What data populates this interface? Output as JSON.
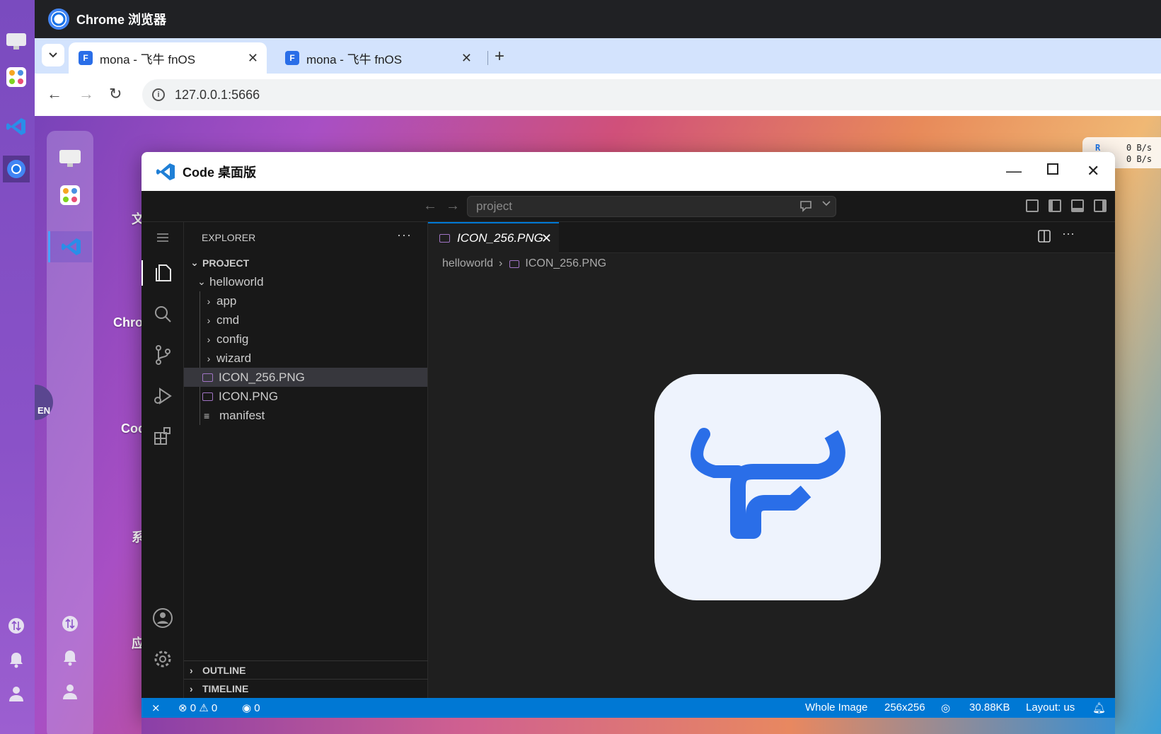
{
  "chrome": {
    "app_title": "Chrome 浏览器",
    "tabs": [
      {
        "label": "mona - 飞牛 fnOS"
      },
      {
        "label": "mona - 飞牛 fnOS"
      }
    ],
    "url": "127.0.0.1:5666"
  },
  "desktop": {
    "labels": [
      "文",
      "Chro",
      "Coc",
      "系",
      "应"
    ],
    "lang_badge": "EN",
    "net": {
      "row1_label": "R",
      "row1_value": "0  B/s",
      "row2_value": "0  B/s"
    }
  },
  "code": {
    "window_title": "Code 桌面版",
    "search_placeholder": "project",
    "explorer": {
      "header": "EXPLORER",
      "project_label": "PROJECT",
      "root_folder": "helloworld",
      "folders": [
        "app",
        "cmd",
        "config",
        "wizard"
      ],
      "files": [
        {
          "name": "ICON_256.PNG",
          "type": "image",
          "selected": true
        },
        {
          "name": "ICON.PNG",
          "type": "image",
          "selected": false
        },
        {
          "name": "manifest",
          "type": "text",
          "selected": false
        }
      ],
      "outline_label": "OUTLINE",
      "timeline_label": "TIMELINE"
    },
    "editor": {
      "active_tab": "ICON_256.PNG",
      "breadcrumb_folder": "helloworld",
      "breadcrumb_file": "ICON_256.PNG"
    },
    "status": {
      "errors": "0",
      "warnings": "0",
      "ports": "0",
      "zoom": "Whole Image",
      "size": "256x256",
      "file_size": "30.88KB",
      "layout": "Layout: us"
    },
    "colors": {
      "accent": "#0078d4",
      "logo_blue": "#2a6ee8",
      "icon_bg": "#eef3fd"
    }
  }
}
